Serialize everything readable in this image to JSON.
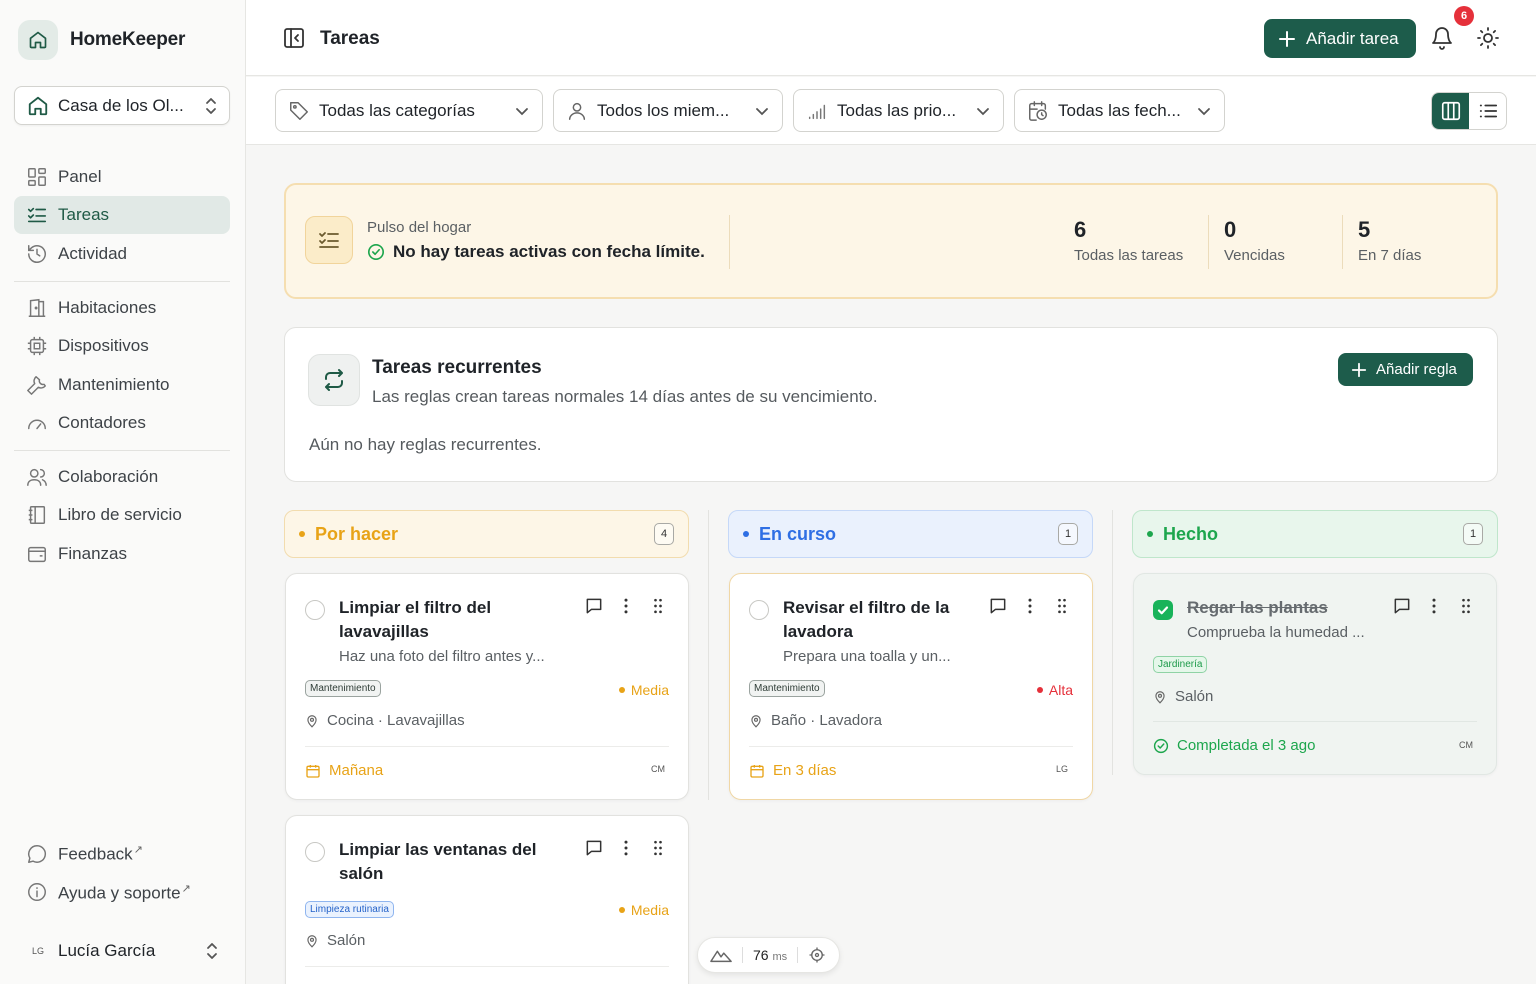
{
  "app": {
    "name": "HomeKeeper"
  },
  "household": {
    "selected": "Casa de los Ol..."
  },
  "nav": {
    "main": [
      {
        "label": "Panel",
        "icon": "dashboard-icon"
      },
      {
        "label": "Tareas",
        "icon": "checklist-icon",
        "active": true
      },
      {
        "label": "Actividad",
        "icon": "history-icon"
      }
    ],
    "manage": [
      {
        "label": "Habitaciones",
        "icon": "door-icon"
      },
      {
        "label": "Dispositivos",
        "icon": "chip-icon"
      },
      {
        "label": "Mantenimiento",
        "icon": "wrench-icon"
      },
      {
        "label": "Contadores",
        "icon": "gauge-icon"
      }
    ],
    "other": [
      {
        "label": "Colaboración",
        "icon": "users-icon"
      },
      {
        "label": "Libro de servicio",
        "icon": "book-icon"
      },
      {
        "label": "Finanzas",
        "icon": "wallet-icon"
      }
    ],
    "footer": [
      {
        "label": "Feedback",
        "icon": "chat-icon"
      },
      {
        "label": "Ayuda y soporte",
        "icon": "info-icon"
      }
    ]
  },
  "user": {
    "name": "Lucía García",
    "initials": "LG"
  },
  "header": {
    "title": "Tareas",
    "add_task": "Añadir tarea",
    "notifications": "6"
  },
  "filters": {
    "category": "Todas las categorías",
    "members": "Todos los miem...",
    "priority": "Todas las prio...",
    "dates": "Todas las fech..."
  },
  "pulse": {
    "label": "Pulso del hogar",
    "message": "No hay tareas activas con fecha límite.",
    "stats": [
      {
        "value": "6",
        "label": "Todas las tareas"
      },
      {
        "value": "0",
        "label": "Vencidas"
      },
      {
        "value": "5",
        "label": "En 7 días"
      }
    ]
  },
  "recurring": {
    "title": "Tareas recurrentes",
    "subtitle": "Las reglas crean tareas normales 14 días antes de su vencimiento.",
    "add_rule": "Añadir regla",
    "empty": "Aún no hay reglas recurrentes."
  },
  "columns": {
    "todo": {
      "label": "Por hacer",
      "count": "4",
      "color": "#e8a317"
    },
    "inprogress": {
      "label": "En curso",
      "count": "1",
      "color": "#2f6fe4"
    },
    "done": {
      "label": "Hecho",
      "count": "1",
      "color": "#1da64d"
    }
  },
  "cards": {
    "c1": {
      "title": "Limpiar el filtro del lavavajillas",
      "desc": "Haz una foto del filtro antes y...",
      "tag": "Mantenimiento",
      "priority": "Media",
      "location": "Cocina · Lavavajillas",
      "due": "Mañana",
      "assignee": "CM"
    },
    "c2": {
      "title": "Limpiar las ventanas del salón",
      "tag": "Limpieza rutinaria",
      "priority": "Media",
      "location": "Salón"
    },
    "c3": {
      "title": "Revisar el filtro de la lavadora",
      "desc": "Prepara una toalla y un...",
      "tag": "Mantenimiento",
      "priority": "Alta",
      "location": "Baño · Lavadora",
      "due": "En 3 días",
      "assignee": "LG"
    },
    "c4": {
      "title": "Regar las plantas",
      "desc": "Comprueba la humedad ...",
      "tag": "Jardinería",
      "location": "Salón",
      "completed": "Completada el 3 ago",
      "assignee": "CM"
    }
  },
  "perf": {
    "value": "76",
    "unit": "ms"
  },
  "colors": {
    "accent": "#1d5c4b",
    "medium": "#e8a317",
    "high": "#e5303a",
    "done": "#1da64d"
  }
}
